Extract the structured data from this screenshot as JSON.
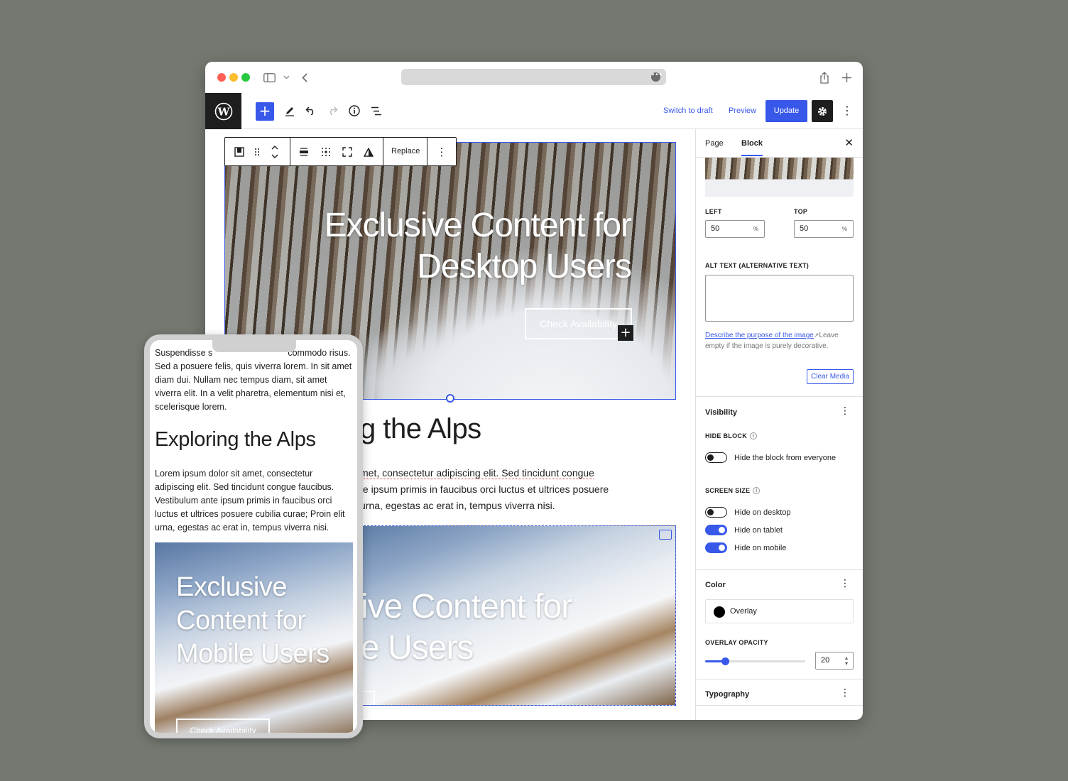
{
  "editor_header": {
    "switch_to_draft": "Switch to draft",
    "preview": "Preview",
    "update": "Update"
  },
  "block_toolbar": {
    "replace": "Replace"
  },
  "canvas": {
    "cover_desktop": {
      "title": "Exclusive Content for Desktop Users",
      "button": "Check Availability"
    },
    "heading_visible": "g the Alps",
    "paragraph_visible_lines": [
      "met, consectetur adipiscing elit. Sed tincidunt congue",
      "te ipsum primis in faucibus orci luctus et ultrices posuere",
      "urna, egestas ac erat in, tempus viverra nisi."
    ],
    "cover_second_visible": {
      "line1": "ive Content for",
      "line2": "e Users"
    }
  },
  "sidebar": {
    "tabs": [
      "Page",
      "Block"
    ],
    "focal_point": {
      "left_label": "LEFT",
      "left_value": "50",
      "top_label": "TOP",
      "top_value": "50",
      "unit": "%"
    },
    "alt_text_label": "ALT TEXT (ALTERNATIVE TEXT)",
    "alt_text_value": "",
    "help_link": "Describe the purpose of the image",
    "help_text": "Leave empty if the image is purely decorative.",
    "clear_media": "Clear Media",
    "visibility": {
      "title": "Visibility",
      "hide_block_label": "HIDE BLOCK",
      "hide_everyone": {
        "label": "Hide the block from everyone",
        "on": false
      },
      "screen_size_label": "SCREEN SIZE",
      "toggles": [
        {
          "label": "Hide on desktop",
          "on": false
        },
        {
          "label": "Hide on tablet",
          "on": true
        },
        {
          "label": "Hide on mobile",
          "on": true
        }
      ]
    },
    "color": {
      "title": "Color",
      "overlay_label": "Overlay",
      "overlay_color": "#000000",
      "opacity_label": "OVERLAY OPACITY",
      "opacity_value": "20",
      "opacity_fraction": 0.2
    },
    "typography_title": "Typography"
  },
  "phone": {
    "para1_start": "Suspendisse s",
    "para1_after_notch": "commodo",
    "para1_rest": "risus. Sed a posuere felis, quis viverra lorem. In sit amet diam dui. Nullam nec tempus diam, sit amet viverra elit. In a velit pharetra, elementum nisi et, scelerisque lorem.",
    "heading": "Exploring the Alps",
    "para2": "Lorem ipsum dolor sit amet, consectetur adipiscing elit. Sed tincidunt congue faucibus. Vestibulum ante ipsum primis in faucibus orci luctus et ultrices posuere cubilia curae; Proin elit urna, egestas ac erat in, tempus viverra nisi.",
    "cover_title": "Exclusive Content for Mobile Users",
    "cover_button": "Check Availability"
  },
  "colors": {
    "accent": "#3858e9",
    "dark": "#1e1e1e",
    "backdrop": "#737870"
  }
}
